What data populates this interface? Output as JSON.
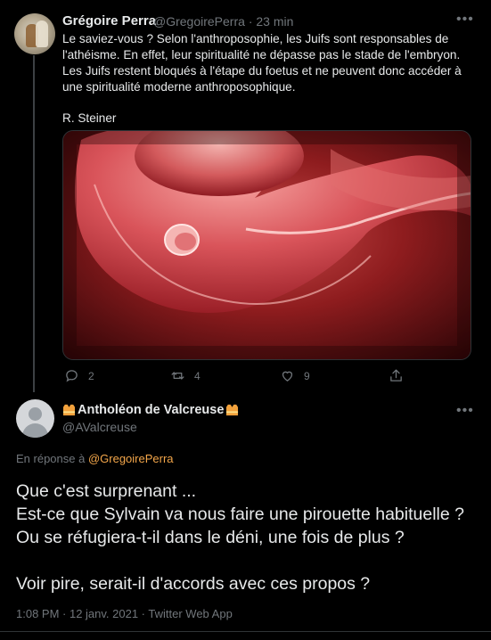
{
  "tweet": {
    "author_name": "Grégoire Perra",
    "author_handle": "@GregoirePerra",
    "time": "· 23 min",
    "more": "•••",
    "text": "Le saviez-vous ? Selon l'anthroposophie, les Juifs sont responsables de l'athéisme. En effet, leur spiritualité ne dépasse pas le stade de l'embryon. Les Juifs restent bloqués à l'étape du foetus et ne peuvent donc accéder à une spiritualité moderne anthroposophique.",
    "signature": "R. Steiner",
    "image_icon": "embryo-photo",
    "actions": {
      "reply_count": "2",
      "retweet_count": "4",
      "like_count": "9"
    }
  },
  "reply": {
    "author_name": "Antholéon de Valcreuse",
    "author_handle": "@AValcreuse",
    "more": "•••",
    "reply_prefix": "En réponse à ",
    "reply_mention": "@GregoirePerra",
    "text_lines": [
      "Que c'est surprenant ...",
      "Est-ce que Sylvain va nous faire une pirouette habituelle ? Ou se réfugiera-t-il dans le déni, une fois de plus ?"
    ],
    "text_final": "Voir pire, serait-il d'accords avec ces propos ?",
    "meta": "1:08 PM · 12 janv. 2021 · Twitter Web App"
  },
  "colors": {
    "background": "#000000",
    "text": "#e7e9ea",
    "muted": "#71767b",
    "mention": "#f3a64a"
  }
}
